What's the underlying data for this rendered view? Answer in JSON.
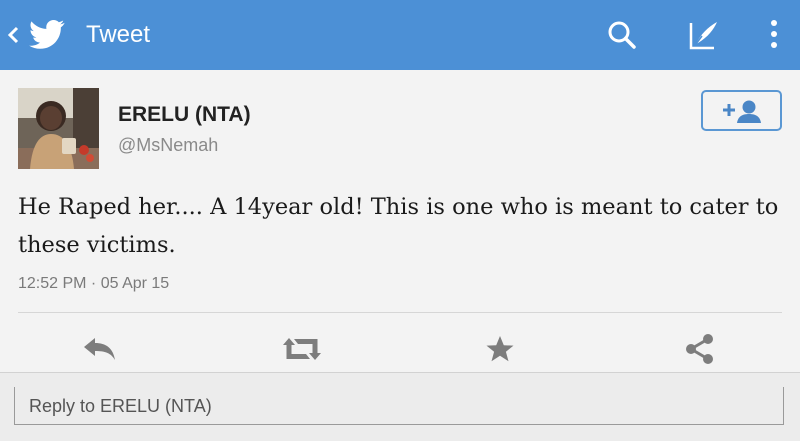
{
  "header": {
    "title": "Tweet",
    "icons": [
      "back-chevron-icon",
      "twitter-bird-icon",
      "search-icon",
      "compose-tweet-icon",
      "overflow-menu-icon"
    ],
    "bar_color": "#4c90d6"
  },
  "tweet": {
    "author_name": "ERELU (NTA)",
    "handle": "@MsNemah",
    "text": "He Raped her.... A 14year old! This is one who is meant to cater to these victims.",
    "timestamp": "12:52 PM · 05 Apr 15",
    "follow_icon": "add-user-icon",
    "accent_color": "#5a97d3"
  },
  "actions": [
    {
      "name": "reply",
      "icon": "reply-icon"
    },
    {
      "name": "retweet",
      "icon": "retweet-icon"
    },
    {
      "name": "favorite",
      "icon": "star-icon"
    },
    {
      "name": "share",
      "icon": "share-icon"
    }
  ],
  "reply": {
    "placeholder": "Reply to ERELU (NTA)"
  }
}
